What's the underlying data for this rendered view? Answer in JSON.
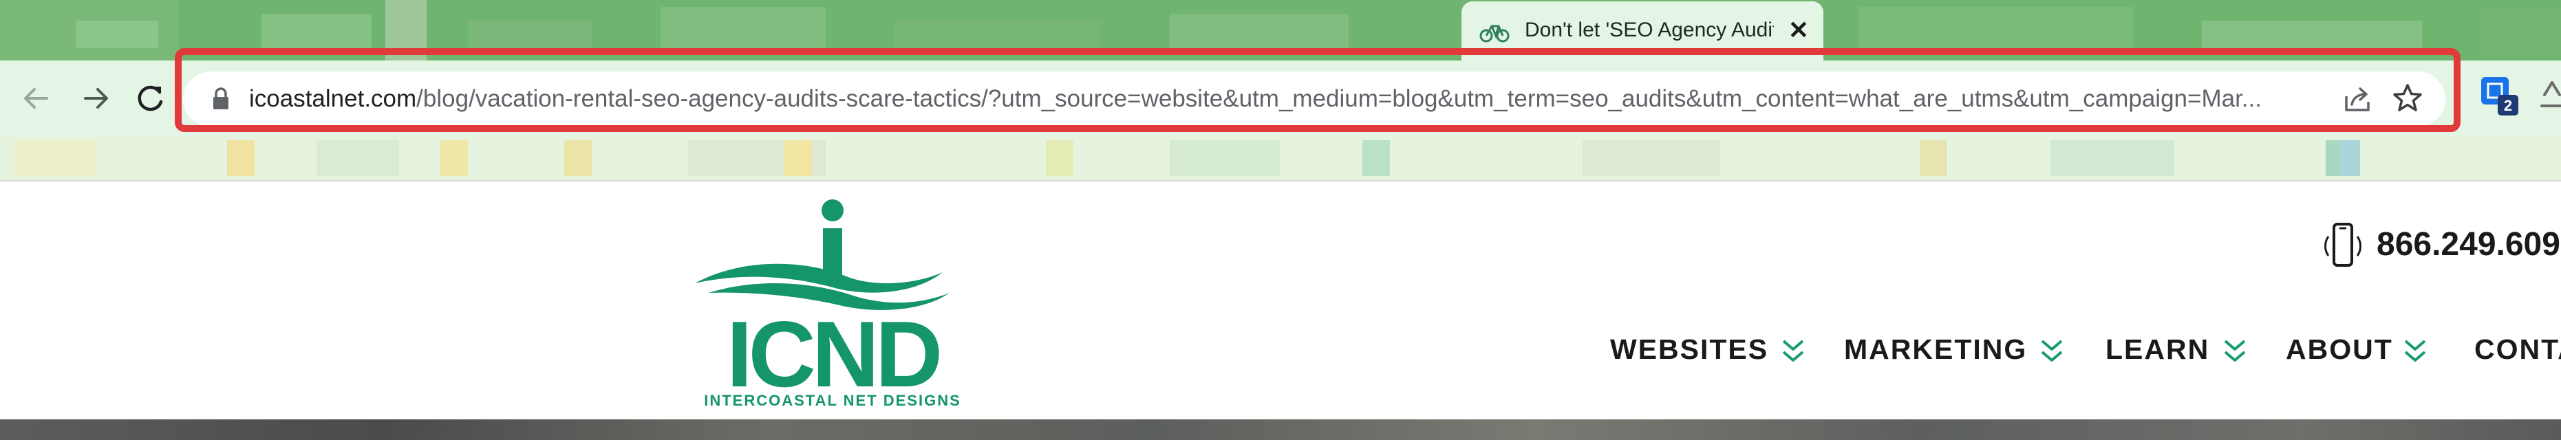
{
  "browser": {
    "tab": {
      "title": "Don't let 'SEO Agency Audits' Scare You",
      "icon": "bicycle-icon",
      "close_label": "✕"
    },
    "toolbar": {
      "back_icon": "back-arrow-icon",
      "forward_icon": "forward-arrow-icon",
      "reload_icon": "reload-icon"
    },
    "omnibox": {
      "url_host": "icoastalnet.com",
      "url_path": "/blog/vacation-rental-seo-agency-audits-scare-tactics/?utm_source=website&utm_medium=blog&utm_term=seo_audits&utm_content=what_are_utms&utm_campaign=Mar...",
      "lock_icon": "lock-icon",
      "share_icon": "share-icon",
      "star_icon": "bookmark-star-icon",
      "highlight_color": "#e03a3a"
    },
    "extensions": {
      "badge_count": "2"
    },
    "colors": {
      "tabstrip": "#6fb56f",
      "toolbar": "#e4f5e5"
    }
  },
  "site": {
    "logo": {
      "text": "ICND",
      "tagline": "INTERCOASTAL NET DESIGNS",
      "color": "#14956a"
    },
    "phone": "866.249.609",
    "nav": [
      {
        "label": "WEBSITES"
      },
      {
        "label": "MARKETING"
      },
      {
        "label": "LEARN"
      },
      {
        "label": "ABOUT"
      },
      {
        "label": "CONTA"
      }
    ],
    "accent_color": "#1a9b6e"
  }
}
